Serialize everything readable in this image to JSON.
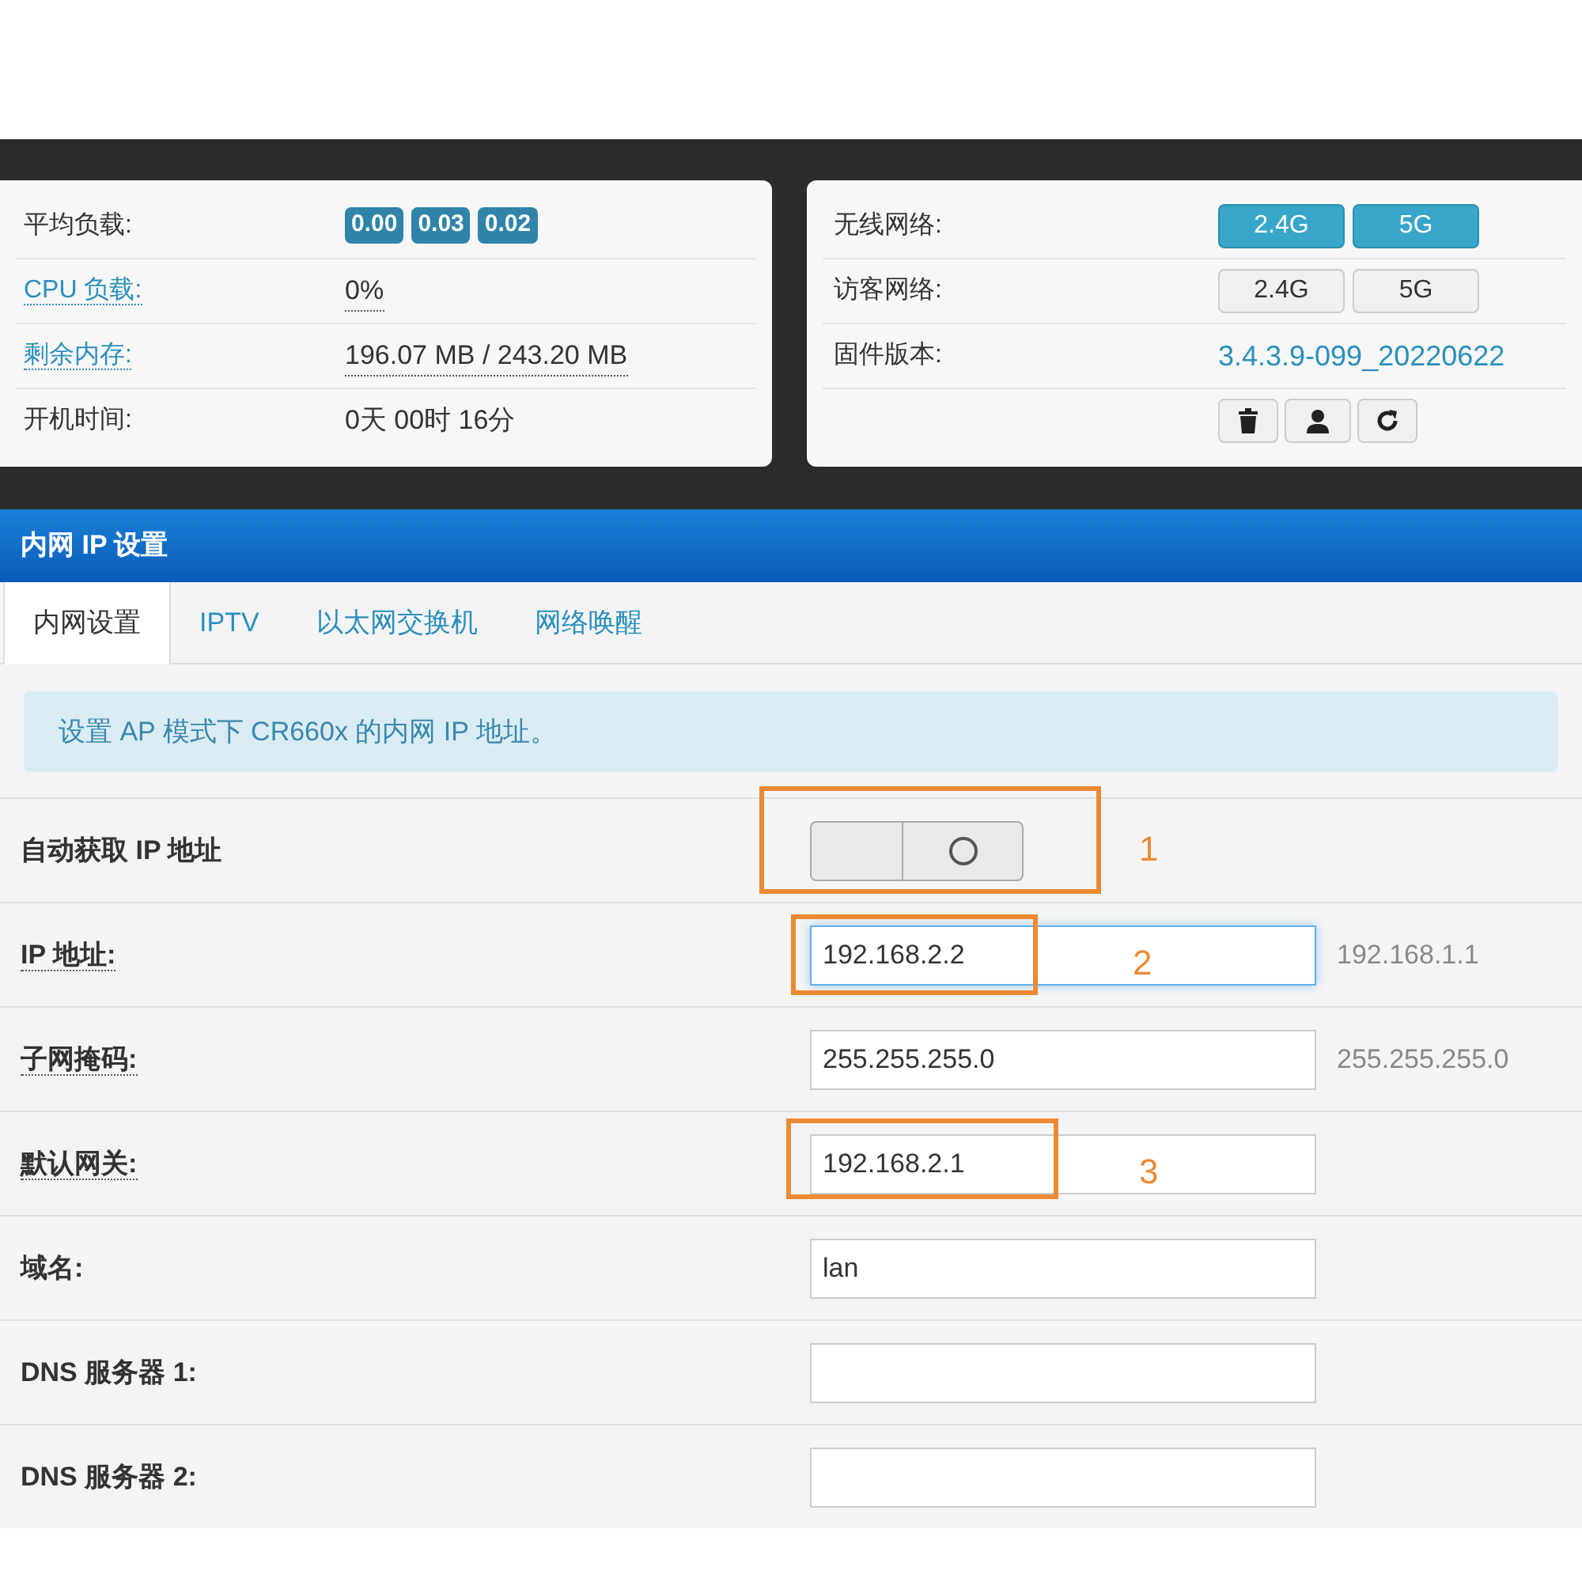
{
  "status_left": [
    {
      "label": "平均负载:",
      "link": false,
      "kind": "badges",
      "badges": [
        "0.00",
        "0.03",
        "0.02"
      ]
    },
    {
      "label": "CPU 负载:",
      "link": true,
      "kind": "text",
      "value": "0%",
      "dotted": true
    },
    {
      "label": "剩余内存:",
      "link": true,
      "kind": "text",
      "value": "196.07 MB / 243.20 MB",
      "dotted": true
    },
    {
      "label": "开机时间:",
      "link": false,
      "kind": "text",
      "value": "0天 00时 16分",
      "dotted": false
    }
  ],
  "status_right": [
    {
      "label": "无线网络:",
      "kind": "buttons",
      "buttons": [
        {
          "label": "2.4G",
          "selected": true
        },
        {
          "label": "5G",
          "selected": true
        }
      ]
    },
    {
      "label": "访客网络:",
      "kind": "buttons",
      "buttons": [
        {
          "label": "2.4G",
          "selected": false
        },
        {
          "label": "5G",
          "selected": false
        }
      ]
    },
    {
      "label": "固件版本:",
      "kind": "link",
      "value": "3.4.3.9-099_20220622"
    },
    {
      "kind": "icons"
    }
  ],
  "section": {
    "title": "内网 IP 设置"
  },
  "tabs": [
    {
      "label": "内网设置",
      "selected": true
    },
    {
      "label": "IPTV",
      "selected": false
    },
    {
      "label": "以太网交换机",
      "selected": false
    },
    {
      "label": "网络唤醒",
      "selected": false
    }
  ],
  "info": "设置 AP 模式下 CR660x 的内网 IP 地址。",
  "form": [
    {
      "kind": "toggle",
      "label": "自动获取 IP 地址",
      "dotted": false,
      "on": false
    },
    {
      "kind": "input",
      "label": "IP 地址:",
      "dotted": true,
      "value": "192.168.2.2",
      "focused": true,
      "hint": "192.168.1.1"
    },
    {
      "kind": "input",
      "label": "子网掩码:",
      "dotted": true,
      "value": "255.255.255.0",
      "focused": false,
      "hint": "255.255.255.0"
    },
    {
      "kind": "input",
      "label": "默认网关:",
      "dotted": true,
      "value": "192.168.2.1",
      "focused": false
    },
    {
      "kind": "input",
      "label": "域名:",
      "dotted": false,
      "value": "lan",
      "focused": false
    },
    {
      "kind": "input",
      "label": "DNS 服务器 1:",
      "dotted": false,
      "focused": false
    },
    {
      "kind": "input",
      "label": "DNS 服务器 2:",
      "dotted": false,
      "focused": false
    }
  ],
  "annotations": [
    {
      "label": "1"
    },
    {
      "label": "2"
    },
    {
      "label": "3"
    }
  ]
}
